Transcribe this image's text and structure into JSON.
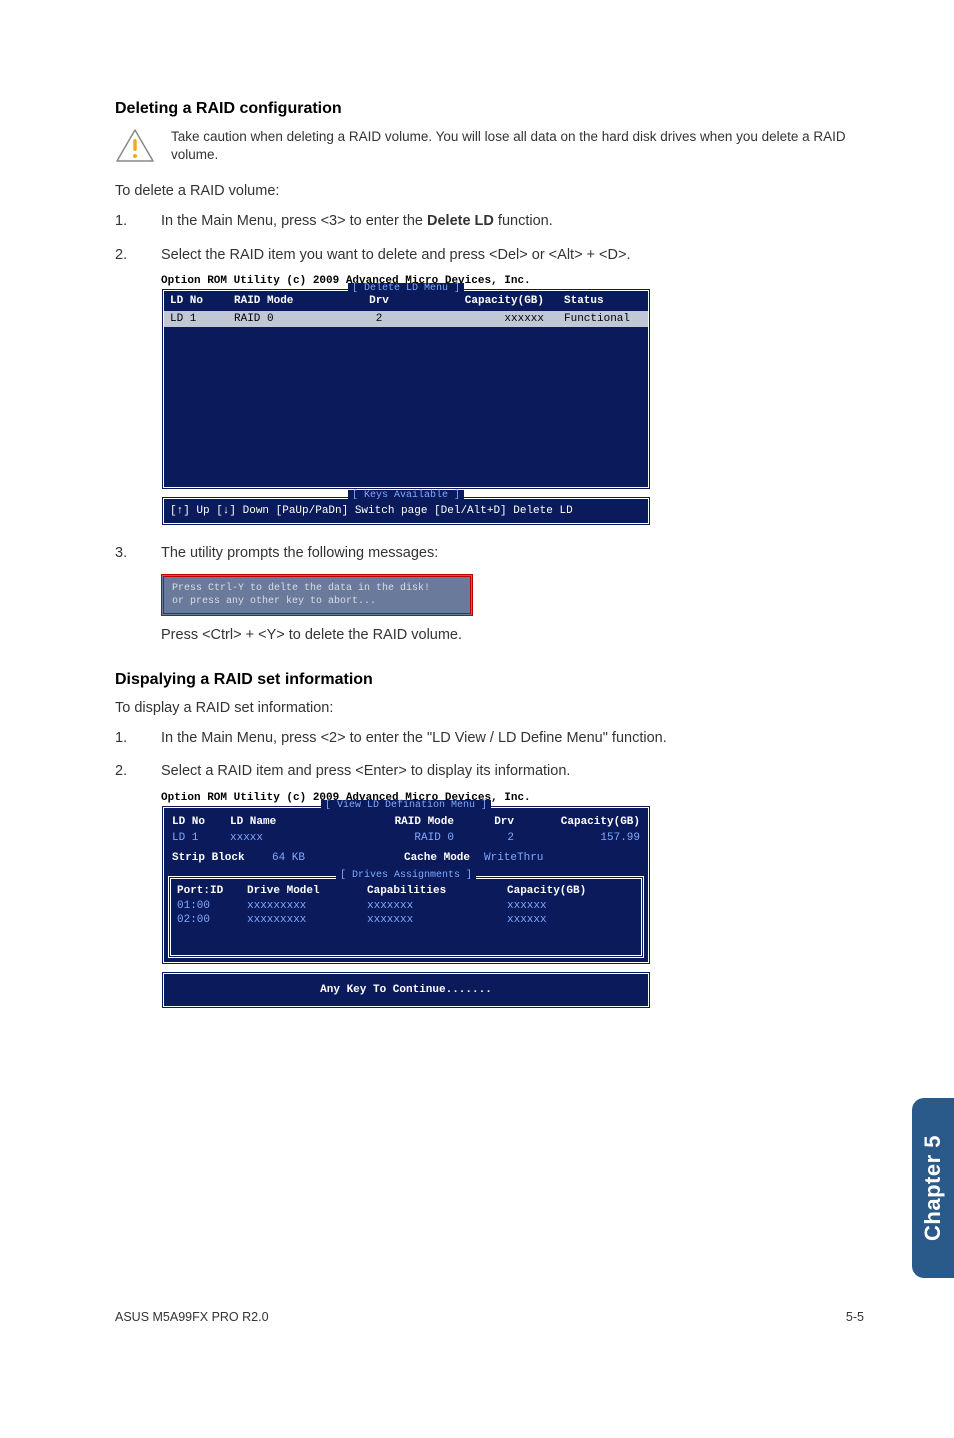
{
  "section1": {
    "heading": "Deleting a RAID configuration",
    "caution": "Take caution when deleting a RAID volume. You will lose all data on the hard disk drives when you delete a RAID volume.",
    "intro": "To delete a RAID volume:",
    "step1_pre": "In the Main Menu, press <3> to enter the ",
    "step1_bold": "Delete LD",
    "step1_post": " function.",
    "step2": "Select the RAID item you want to delete and press <Del> or <Alt> + <D>.",
    "step3": "The utility prompts the following messages:",
    "prompt_line1": "Press Ctrl-Y to delte the data in the disk!",
    "prompt_line2": "or press any other key to abort...",
    "press_ctrl": "Press <Ctrl> + <Y> to delete the RAID volume."
  },
  "bios1": {
    "title": "Option ROM Utility (c) 2009 Advanced Micro Devices, Inc.",
    "section_label": "[ Delete LD Menu ]",
    "headers": {
      "c1": "LD No",
      "c2": "RAID Mode",
      "c3": "Drv",
      "c4": "Capacity(GB)",
      "c5": "Status"
    },
    "row": {
      "c1": "LD  1",
      "c2": "RAID 0",
      "c3": "2",
      "c4": "xxxxxx",
      "c5": "Functional"
    },
    "keys_label": "[ Keys Available ]",
    "keys_text": "[↑] Up  [↓] Down  [PaUp/PaDn] Switch page  [Del/Alt+D] Delete LD"
  },
  "section2": {
    "heading": "Dispalying a RAID set information",
    "intro": "To display a RAID set information:",
    "step1": "In the Main Menu, press <2> to enter the \"LD View / LD Define Menu\" function.",
    "step2": "Select a RAID item and press <Enter> to display its information."
  },
  "bios2": {
    "title": "Option ROM Utility (c) 2009 Advanced Micro Devices, Inc.",
    "section_label": "[ View LD Defination Menu ]",
    "r1_l1": "LD No",
    "r1_l2": "LD Name",
    "r1_l3": "RAID Mode",
    "r1_l4": "Drv",
    "r1_l5": "Capacity(GB)",
    "r2_v1": "LD  1",
    "r2_v2": "xxxxx",
    "r2_v3": "RAID 0",
    "r2_v4": "2",
    "r2_v5": "157.99",
    "r3_l1": "Strip Block",
    "r3_v1": "64 KB",
    "r3_l2": "Cache Mode",
    "r3_v2": "WriteThru",
    "drives_label": "[ Drives Assignments ]",
    "dh1": "Port:ID",
    "dh2": "Drive Model",
    "dh3": "Capabilities",
    "dh4": "Capacity(GB)",
    "drow1": {
      "d1": "01:00",
      "d2": "xxxxxxxxx",
      "d3": "xxxxxxx",
      "d4": "xxxxxx"
    },
    "drow2": {
      "d1": "02:00",
      "d2": "xxxxxxxxx",
      "d3": "xxxxxxx",
      "d4": "xxxxxx"
    },
    "footer": "Any Key To Continue......."
  },
  "sidetab": "Chapter 5",
  "footer_left": "ASUS M5A99FX PRO R2.0",
  "footer_right": "5-5",
  "num1": "1.",
  "num2": "2.",
  "num3": "3."
}
